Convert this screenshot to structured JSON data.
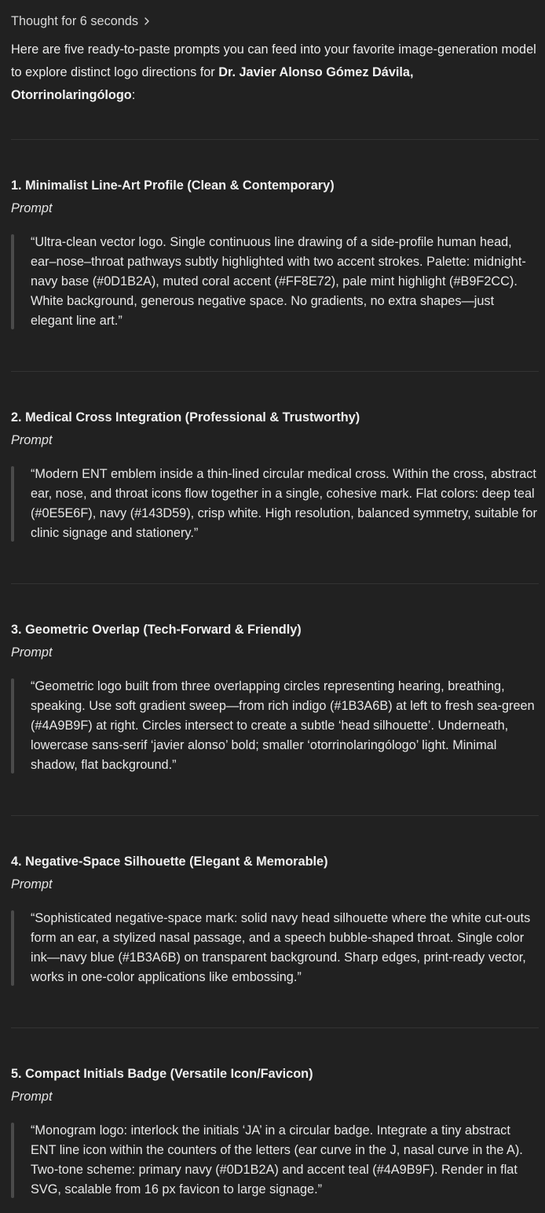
{
  "thought": {
    "label": "Thought for 6 seconds"
  },
  "intro": {
    "text": "Here are five ready-to-paste prompts you can feed into your favorite image-generation model to explore distinct logo directions for ",
    "name": "Dr. Javier Alonso Gómez Dávila, Otorrinolaringólogo",
    "suffix": ":"
  },
  "sections": [
    {
      "title": "1. Minimalist Line-Art Profile (Clean & Contemporary)",
      "prompt_label": "Prompt",
      "quote": "“Ultra-clean vector logo. Single continuous line drawing of a side-profile human head, ear–nose–throat pathways subtly highlighted with two accent strokes. Palette: midnight-navy base (#0D1B2A), muted coral accent (#FF8E72), pale mint highlight (#B9F2CC). White background, generous negative space. No gradients, no extra shapes—just elegant line art.”"
    },
    {
      "title": "2. Medical Cross Integration (Professional & Trustworthy)",
      "prompt_label": "Prompt",
      "quote": "“Modern ENT emblem inside a thin-lined circular medical cross. Within the cross, abstract ear, nose, and throat icons flow together in a single, cohesive mark. Flat colors: deep teal (#0E5E6F), navy (#143D59), crisp white. High resolution, balanced symmetry, suitable for clinic signage and stationery.”"
    },
    {
      "title": "3. Geometric Overlap (Tech-Forward & Friendly)",
      "prompt_label": "Prompt",
      "quote": "“Geometric logo built from three overlapping circles representing hearing, breathing, speaking. Use soft gradient sweep—from rich indigo (#1B3A6B) at left to fresh sea-green (#4A9B9F) at right. Circles intersect to create a subtle ‘head silhouette’. Underneath, lowercase sans-serif ‘javier alonso’ bold; smaller ‘otorrinolaringólogo’ light. Minimal shadow, flat background.”"
    },
    {
      "title": "4. Negative-Space Silhouette (Elegant & Memorable)",
      "prompt_label": "Prompt",
      "quote": "“Sophisticated negative-space mark: solid navy head silhouette where the white cut-outs form an ear, a stylized nasal passage, and a speech bubble-shaped throat. Single color ink—navy blue (#1B3A6B) on transparent background. Sharp edges, print-ready vector, works in one-color applications like embossing.”"
    },
    {
      "title": "5. Compact Initials Badge (Versatile Icon/Favicon)",
      "prompt_label": "Prompt",
      "quote": "“Monogram logo: interlock the initials ‘JA’ in a circular badge. Integrate a tiny abstract ENT line icon within the counters of the letters (ear curve in the J, nasal curve in the A). Two-tone scheme: primary navy (#0D1B2A) and accent teal (#4A9B9F). Render in flat SVG, scalable from 16 px favicon to large signage.”"
    }
  ]
}
